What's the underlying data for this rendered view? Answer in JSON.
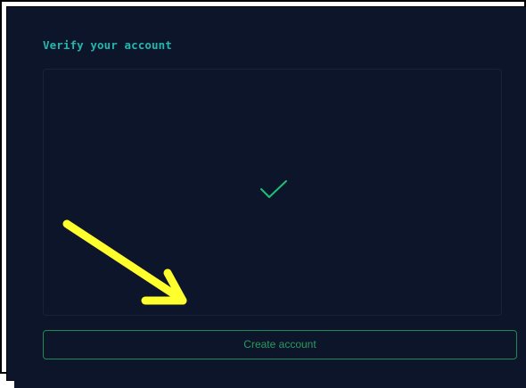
{
  "panel": {
    "title": "Verify your account"
  },
  "verification": {
    "status_icon": "checkmark-icon",
    "status_color": "#1fbf7a"
  },
  "actions": {
    "create_account_label": "Create account"
  },
  "annotation": {
    "arrow_icon": "arrow-down-right-icon",
    "arrow_color": "#ffff2e"
  },
  "colors": {
    "background": "#0c1529",
    "title": "#24b6ad",
    "button_border": "#1f8a52",
    "button_text": "#2b9a5f"
  }
}
